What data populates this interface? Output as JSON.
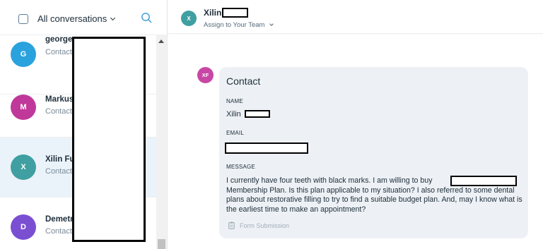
{
  "colors": {
    "accent": "#3a9bd6",
    "active_row_bg": "#eaf3fa",
    "card_bg": "#edf1f5",
    "avatar_teal": "#3f9fa1",
    "avatar_blue": "#2aa2dd",
    "avatar_magenta": "#c0389a",
    "avatar_purple": "#7a4fd2",
    "avatar_xf": "#c847a4"
  },
  "list_header": {
    "filter_label": "All conversations",
    "filter_icon": "chevron-down-icon",
    "search_icon": "search-icon"
  },
  "conversations": [
    {
      "initial": "G",
      "name": "george",
      "subtitle": "Contact",
      "color": "#2aa2dd",
      "active": false
    },
    {
      "initial": "M",
      "name": "Markus",
      "subtitle": "Contact",
      "color": "#c0389a",
      "active": false
    },
    {
      "initial": "X",
      "name": "Xilin Fu",
      "subtitle": "Contact",
      "color": "#3f9fa1",
      "active": true
    },
    {
      "initial": "D",
      "name": "Demetr",
      "subtitle": "Contact",
      "color": "#7a4fd2",
      "active": false
    }
  ],
  "header": {
    "avatar_initial": "X",
    "name": "Xilin",
    "assign_label": "Assign to Your Team"
  },
  "message": {
    "avatar_initials": "XF",
    "card_title": "Contact",
    "name_label": "NAME",
    "name_value": "Xilin",
    "email_label": "EMAIL",
    "message_label": "MESSAGE",
    "message_before": "I currently have four teeth with black marks. I am willing to buy",
    "message_after": "Membership Plan. Is this plan applicable to my situation? I also referred to some dental plans about restorative filling to try to find a suitable budget plan. And, may I know what is the earliest time to make an appointment?",
    "footer": "Form Submission",
    "footer_icon": "clipboard-icon"
  }
}
